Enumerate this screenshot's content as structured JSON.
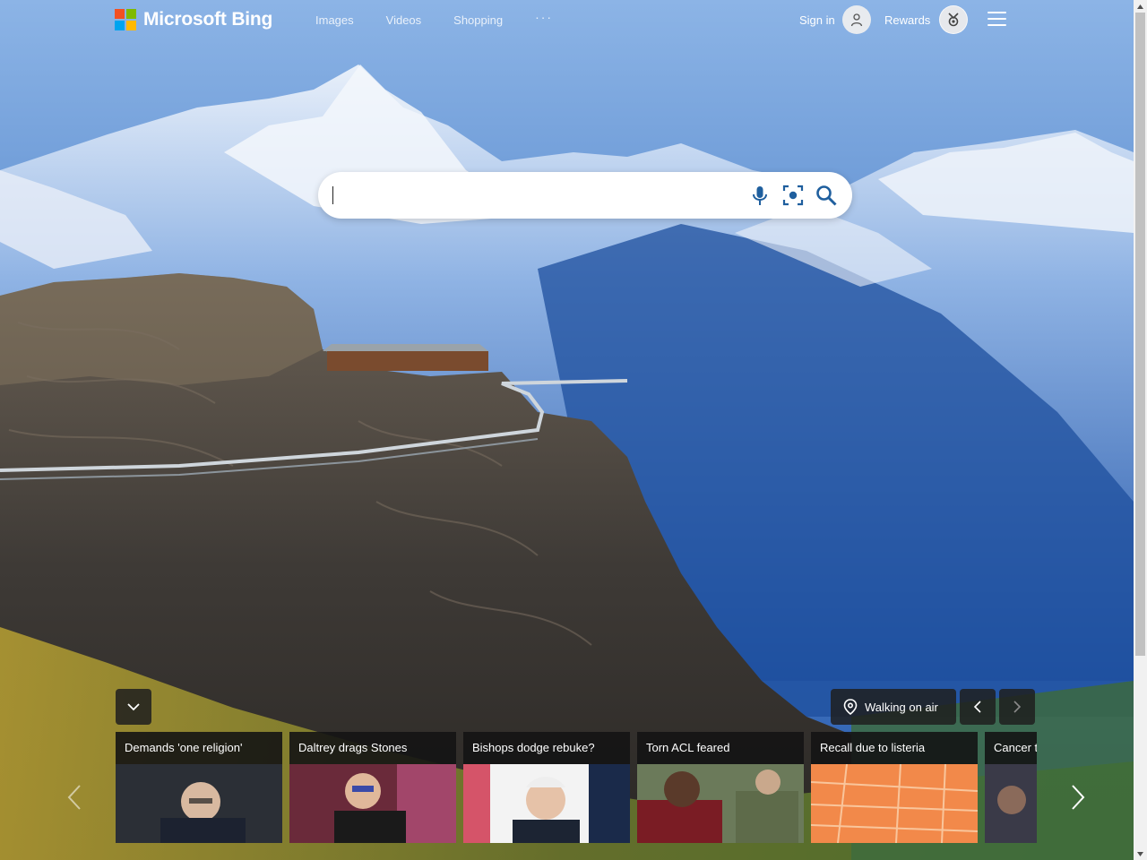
{
  "brand": {
    "name": "Microsoft Bing",
    "logo_colors": [
      "#f25022",
      "#7fba00",
      "#00a4ef",
      "#ffb900"
    ]
  },
  "nav": {
    "items": [
      "Images",
      "Videos",
      "Shopping"
    ],
    "more": "···"
  },
  "account": {
    "signin_label": "Sign in",
    "rewards_label": "Rewards"
  },
  "search": {
    "value": "",
    "icons": [
      "microphone-icon",
      "visual-search-icon",
      "search-icon"
    ]
  },
  "image_of_day": {
    "location_label": "Walking on air"
  },
  "news": [
    {
      "title": "Demands 'one religion'"
    },
    {
      "title": "Daltrey drags Stones"
    },
    {
      "title": "Bishops dodge rebuke?"
    },
    {
      "title": "Torn ACL feared"
    },
    {
      "title": "Recall due to listeria"
    },
    {
      "title": "Cancer t"
    }
  ],
  "colors": {
    "sky": "#6b9cd8",
    "mountain": "#2d5aa0",
    "card_bg": "#141414",
    "search_icon": "#1f5f9e"
  }
}
